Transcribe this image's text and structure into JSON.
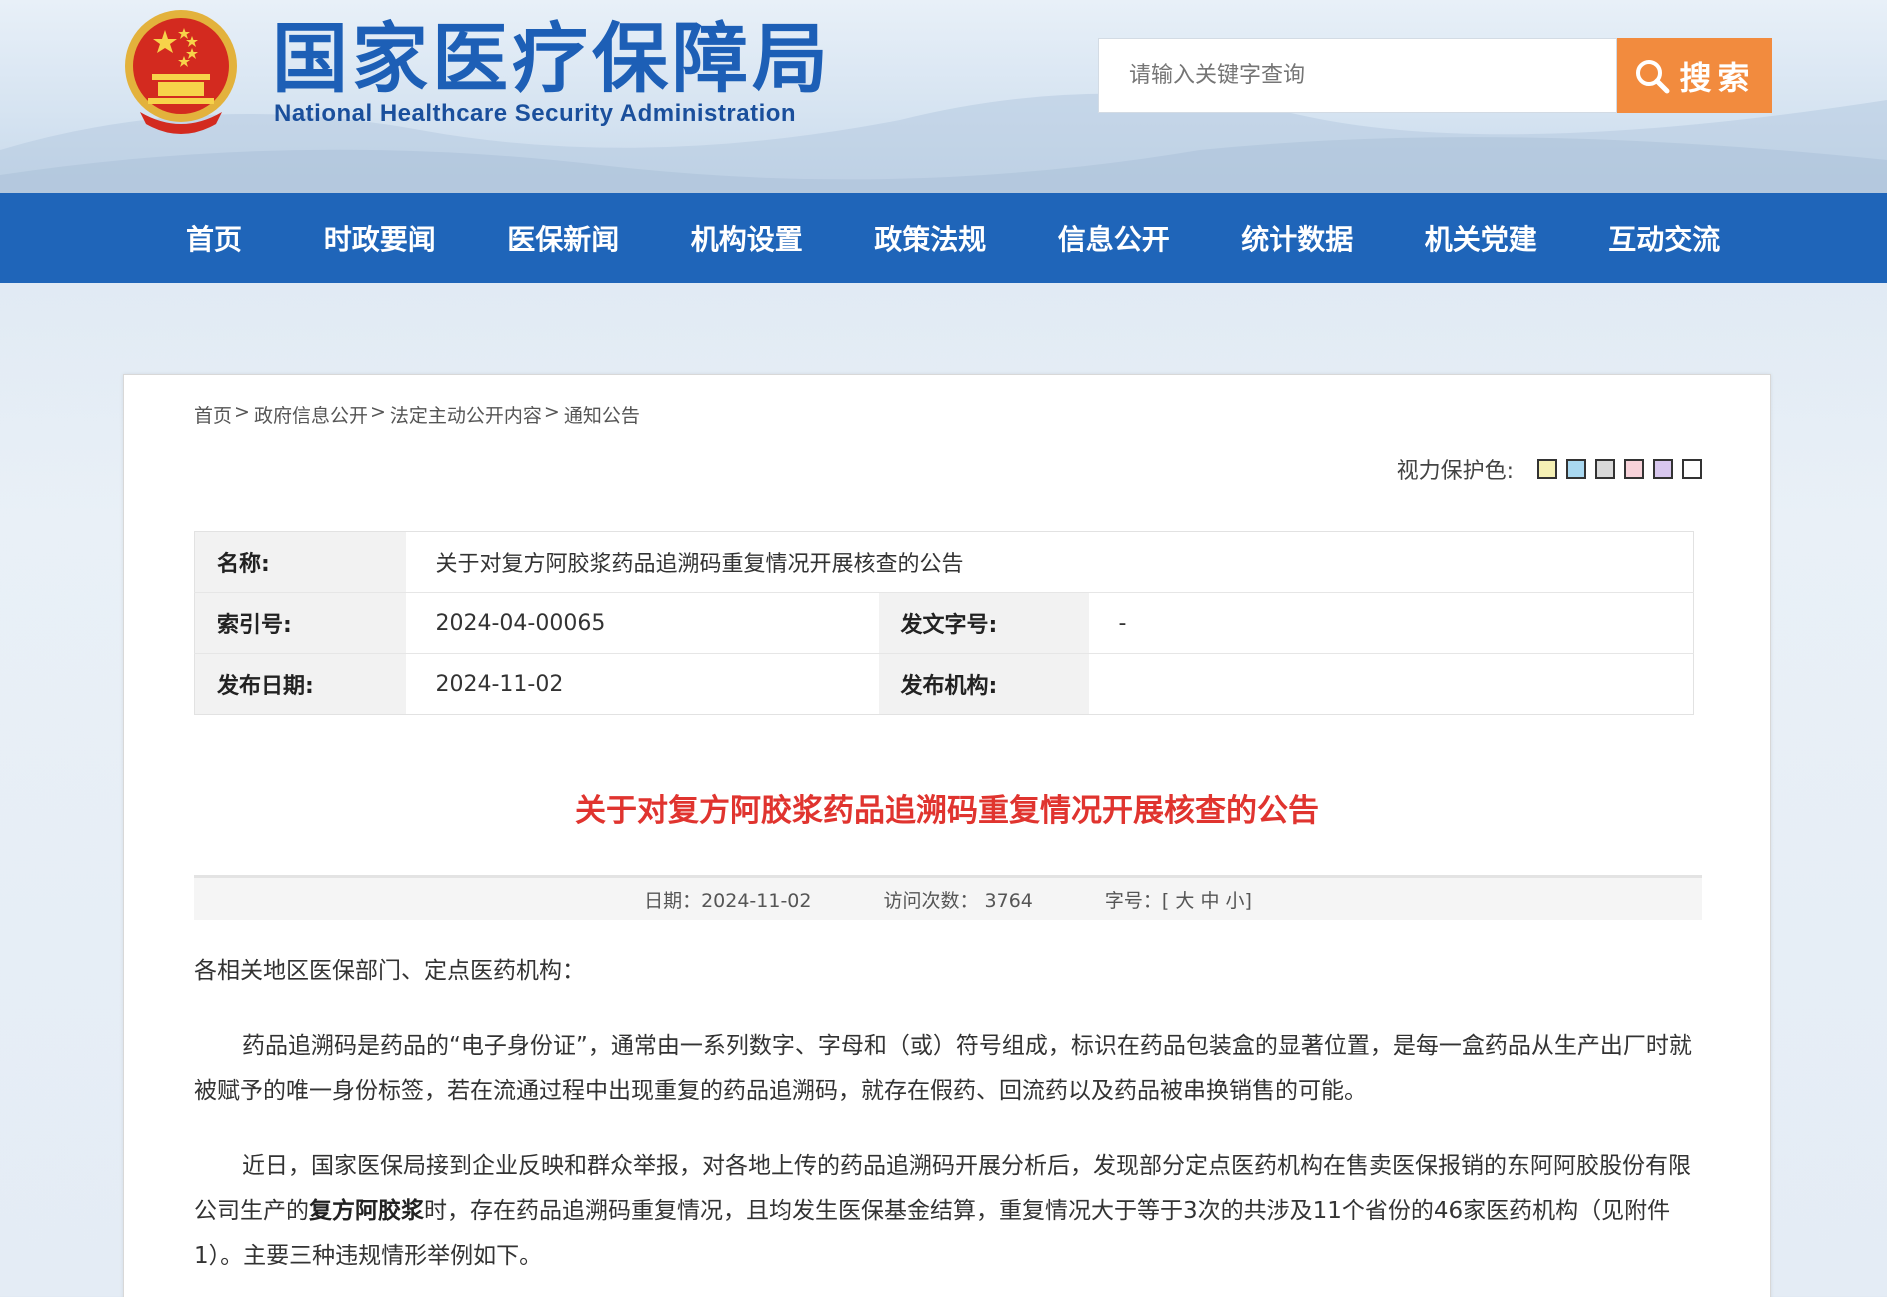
{
  "header": {
    "title": "国家医疗保障局",
    "subtitle": "National Healthcare Security Administration",
    "search_placeholder": "请输入关键字查询",
    "search_button": "搜索"
  },
  "nav": {
    "items": [
      "首页",
      "时政要闻",
      "医保新闻",
      "机构设置",
      "政策法规",
      "信息公开",
      "统计数据",
      "机关党建",
      "互动交流"
    ]
  },
  "breadcrumb": [
    "首页",
    "政府信息公开",
    "法定主动公开内容",
    "通知公告"
  ],
  "vision": {
    "label": "视力保护色:",
    "colors": [
      "#f5f0b4",
      "#a9d8f0",
      "#d9d9d9",
      "#f7d2d9",
      "#d8c7ee",
      "#ffffff"
    ]
  },
  "meta": {
    "name_label": "名称:",
    "name_value": "关于对复方阿胶浆药品追溯码重复情况开展核查的公告",
    "index_label": "索引号:",
    "index_value": "2024-04-00065",
    "doc_no_label": "发文字号:",
    "doc_no_value": "-",
    "date_label": "发布日期:",
    "date_value": "2024-11-02",
    "org_label": "发布机构:",
    "org_value": ""
  },
  "article": {
    "title": "关于对复方阿胶浆药品追溯码重复情况开展核查的公告",
    "date": "日期：2024-11-02",
    "visits": "访问次数：  3764",
    "size_label": "字号：",
    "size_open": "[",
    "size_big": "大",
    "size_mid": "中",
    "size_small": "小",
    "size_close": "]",
    "greeting": "各相关地区医保部门、定点医药机构：",
    "p1": "药品追溯码是药品的“电子身份证”，通常由一系列数字、字母和（或）符号组成，标识在药品包装盒的显著位置，是每一盒药品从生产出厂时就被赋予的唯一身份标签，若在流通过程中出现重复的药品追溯码，就存在假药、回流药以及药品被串换销售的可能。",
    "p2_a": "近日，国家医保局接到企业反映和群众举报，对各地上传的药品追溯码开展分析后，发现部分定点医药机构在售卖医保报销的东阿阿胶股份有限公司生产的",
    "p2_bold": "复方阿胶浆",
    "p2_b": "时，存在药品追溯码重复情况，且均发生医保基金结算，重复情况大于等于3次的共涉及11个省份的46家医药机构（见附件1）。主要三种违规情形举例如下。"
  }
}
